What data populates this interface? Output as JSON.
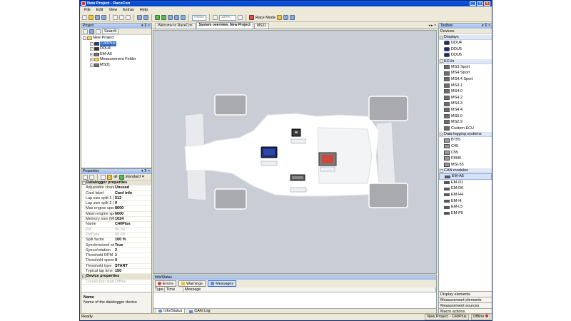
{
  "window": {
    "title": "New Project - RaceCon"
  },
  "menu": [
    "File",
    "Edit",
    "View",
    "Extras",
    "Help"
  ],
  "toolbar": {
    "mode_combo": "Online",
    "zoom_combo": "100%",
    "race_mode": "Race Mode"
  },
  "project": {
    "title": "Project",
    "search_label": "Search",
    "tree": [
      {
        "label": "New Project",
        "level": 0
      },
      {
        "label": "C40Plus",
        "level": 1,
        "selected": true
      },
      {
        "label": "DDU4",
        "level": 1
      },
      {
        "label": "EM-A6",
        "level": 1
      },
      {
        "label": "Measurement Folder",
        "level": 1
      },
      {
        "label": "MS31",
        "level": 1
      }
    ]
  },
  "properties": {
    "title": "Properties",
    "filter_all": "all",
    "filter_standard": "standard",
    "cat1": "Datalogger properties",
    "rows1": [
      {
        "k": "Adjustable chann",
        "v": "Unused"
      },
      {
        "k": "Card label",
        "v": "Card info"
      },
      {
        "k": "Lap size split 1 (K",
        "v": "512"
      },
      {
        "k": "Lap size split 2 (K",
        "v": "0"
      },
      {
        "k": "Max engine spee",
        "v": "8000"
      },
      {
        "k": "Mean engine spe",
        "v": "6000"
      },
      {
        "k": "Memory size (MB",
        "v": "1024"
      },
      {
        "k": "Name",
        "v": "C40Plus"
      },
      {
        "k": "Pid",
        "v": "00.00",
        "dis": true
      },
      {
        "k": "PidDate",
        "v": "00.00",
        "dis": true
      },
      {
        "k": "Split factor",
        "v": "100 %"
      },
      {
        "k": "Synchronized wit",
        "v": "True"
      },
      {
        "k": "Syncs/rotation",
        "v": "2"
      },
      {
        "k": "Threshold RPM [",
        "v": "1"
      },
      {
        "k": "Threshold speed",
        "v": "0"
      },
      {
        "k": "Threshold type",
        "v": "START"
      },
      {
        "k": "Typical lap time",
        "v": "150"
      }
    ],
    "cat2": "Device properties",
    "rows2": [
      {
        "k": "Connection state",
        "v": "Offline",
        "dis": true
      }
    ],
    "desc_title": "Name",
    "desc_text": "Name of the datalogger device"
  },
  "doc_tabs": [
    "Welcome to RaceCon",
    "System overview: New Project",
    "MS31"
  ],
  "info": {
    "title": "Info/Status",
    "errors": "Errors",
    "warnings": "Warnings",
    "messages": "Messages",
    "cols": [
      "Type",
      "Time",
      "Message"
    ],
    "tab_info": "Info/Status",
    "tab_can": "CAN Log"
  },
  "toolbox": {
    "title": "Toolbox",
    "tab": "Devices",
    "categories": [
      {
        "name": "Displays",
        "items": [
          "DDU4",
          "DDU5",
          "DDU6"
        ],
        "icon": "disp"
      },
      {
        "name": "ECUs",
        "items": [
          "MS3 Sport",
          "MS4 Sport",
          "MS4.4 Sport",
          "MS3.1",
          "MS4.0",
          "MS4.2",
          "MS4.3",
          "MS4.4",
          "MS5.0",
          "MS2.9",
          "Custom ECU"
        ],
        "icon": "ecu"
      },
      {
        "name": "Data logging systems",
        "items": [
          "BT55",
          "C40",
          "C55",
          "FM40",
          "MSI-55"
        ],
        "icon": "log"
      },
      {
        "name": "CAN modules",
        "items": [
          "EM-A6",
          "EM-D1",
          "EM-D6",
          "EM-H4",
          "EM-I4",
          "EM-L5",
          "EM-P5"
        ],
        "icon": "can",
        "highlight": "EM-A6"
      }
    ],
    "footer": [
      "Display elements",
      "Measurement elements",
      "Measurement sources",
      "Macro actions"
    ]
  },
  "status": {
    "left": "Ready.",
    "project": "New Project - C40Plus",
    "state": "Offline"
  }
}
